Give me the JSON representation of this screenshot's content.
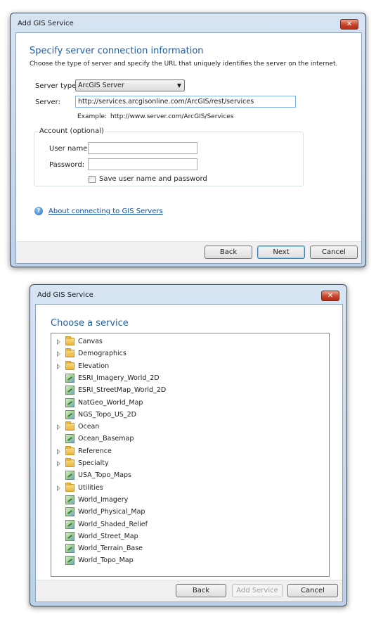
{
  "dialog1": {
    "title": "Add GIS Service",
    "close_label": "✕",
    "heading": "Specify server connection information",
    "description": "Choose the type of server and specify the URL that uniquely identifies the server on the internet.",
    "server_type_label": "Server type:",
    "server_type_value": "ArcGIS Server",
    "server_label": "Server:",
    "server_value": "http://services.arcgisonline.com/ArcGIS/rest/services",
    "example_label": "Example:",
    "example_value": "http://www.server.com/ArcGIS/Services",
    "account_group_label": "Account (optional)",
    "username_label": "User name:",
    "username_value": "",
    "password_label": "Password:",
    "password_value": "",
    "save_checkbox_label": "Save user name and password",
    "save_checked": false,
    "help_icon": "question-circle-icon",
    "help_link": "About connecting to GIS Servers",
    "buttons": {
      "back": "Back",
      "next": "Next",
      "cancel": "Cancel"
    }
  },
  "dialog2": {
    "title": "Add GIS Service",
    "close_label": "✕",
    "heading": "Choose a service",
    "items": [
      {
        "label": "Canvas",
        "type": "folder",
        "expandable": true
      },
      {
        "label": "Demographics",
        "type": "folder",
        "expandable": true
      },
      {
        "label": "Elevation",
        "type": "folder",
        "expandable": true
      },
      {
        "label": "ESRI_Imagery_World_2D",
        "type": "map",
        "expandable": false
      },
      {
        "label": "ESRI_StreetMap_World_2D",
        "type": "map",
        "expandable": false
      },
      {
        "label": "NatGeo_World_Map",
        "type": "map",
        "expandable": false
      },
      {
        "label": "NGS_Topo_US_2D",
        "type": "map",
        "expandable": false
      },
      {
        "label": "Ocean",
        "type": "folder",
        "expandable": true
      },
      {
        "label": "Ocean_Basemap",
        "type": "map",
        "expandable": false
      },
      {
        "label": "Reference",
        "type": "folder",
        "expandable": true
      },
      {
        "label": "Specialty",
        "type": "folder",
        "expandable": true
      },
      {
        "label": "USA_Topo_Maps",
        "type": "map",
        "expandable": false
      },
      {
        "label": "Utilities",
        "type": "folder",
        "expandable": true
      },
      {
        "label": "World_Imagery",
        "type": "map",
        "expandable": false
      },
      {
        "label": "World_Physical_Map",
        "type": "map",
        "expandable": false
      },
      {
        "label": "World_Shaded_Relief",
        "type": "map",
        "expandable": false
      },
      {
        "label": "World_Street_Map",
        "type": "map",
        "expandable": false
      },
      {
        "label": "World_Terrain_Base",
        "type": "map",
        "expandable": false
      },
      {
        "label": "World_Topo_Map",
        "type": "map",
        "expandable": false
      }
    ],
    "buttons": {
      "back": "Back",
      "add_service": "Add Service",
      "cancel": "Cancel"
    }
  },
  "colors": {
    "heading": "#1e5fa8",
    "link": "#0b4ea2",
    "close_button": "#c8452c"
  }
}
